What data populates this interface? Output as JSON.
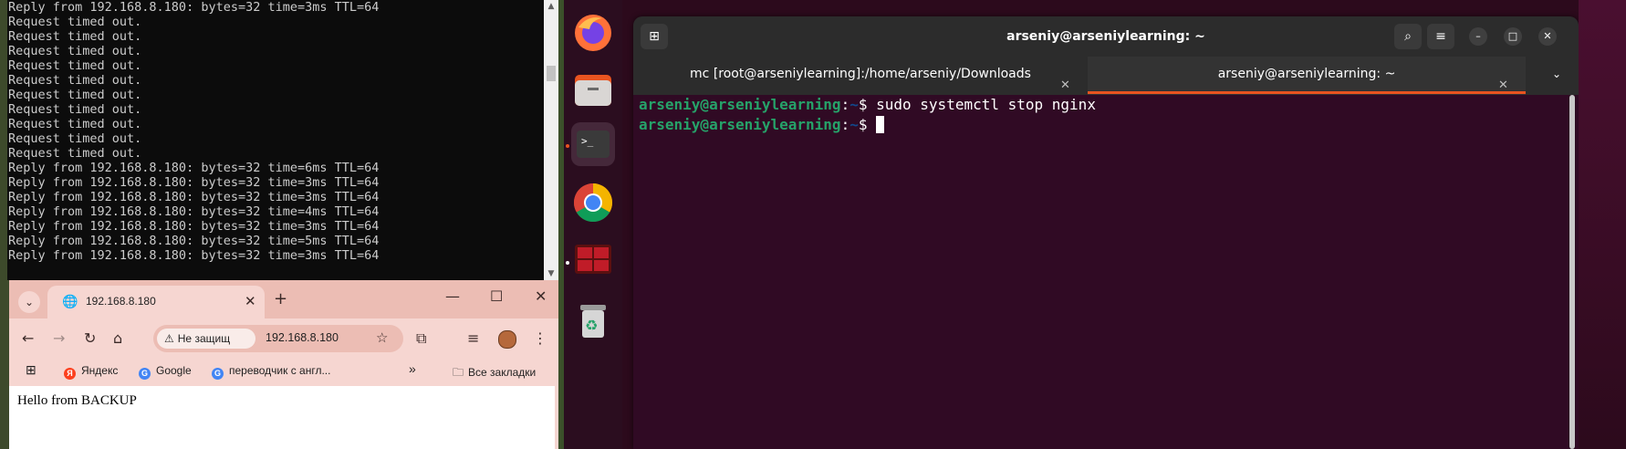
{
  "cmd": {
    "lines": [
      "Reply from 192.168.8.180: bytes=32 time=3ms TTL=64",
      "Request timed out.",
      "Request timed out.",
      "Request timed out.",
      "Request timed out.",
      "Request timed out.",
      "Request timed out.",
      "Request timed out.",
      "Request timed out.",
      "Request timed out.",
      "Request timed out.",
      "Reply from 192.168.8.180: bytes=32 time=6ms TTL=64",
      "Reply from 192.168.8.180: bytes=32 time=3ms TTL=64",
      "Reply from 192.168.8.180: bytes=32 time=3ms TTL=64",
      "Reply from 192.168.8.180: bytes=32 time=4ms TTL=64",
      "Reply from 192.168.8.180: bytes=32 time=3ms TTL=64",
      "Reply from 192.168.8.180: bytes=32 time=5ms TTL=64",
      "Reply from 192.168.8.180: bytes=32 time=3ms TTL=64"
    ]
  },
  "browser": {
    "tab_title": "192.168.8.180",
    "security_chip": "Не защищ",
    "url": "192.168.8.180",
    "bookmarks": [
      "Яндекс",
      "Google",
      "переводчик с англ...",
      "Все закладки"
    ],
    "page_text": "Hello from BACKUP"
  },
  "terminal": {
    "window_title": "arseniy@arseniylearning: ~",
    "tabs": [
      {
        "label": "mc [root@arseniylearning]:/home/arseniy/Downloads"
      },
      {
        "label": "arseniy@arseniylearning: ~"
      }
    ],
    "prompt_user": "arseniy@arseniylearning",
    "prompt_path": "~",
    "prompt_symbol": "$",
    "command_1": "sudo systemctl stop nginx",
    "command_2": ""
  },
  "dock": {
    "apps": [
      "firefox-icon",
      "files-icon",
      "terminal-icon",
      "chrome-icon",
      "terminal-emulator-icon",
      "trash-icon"
    ]
  },
  "colors": {
    "ubuntu_orange": "#e95420",
    "terminal_bg": "#300a24",
    "prompt_green": "#26a269",
    "prompt_blue": "#12488b",
    "chrome_theme": "#f6d6d1"
  }
}
